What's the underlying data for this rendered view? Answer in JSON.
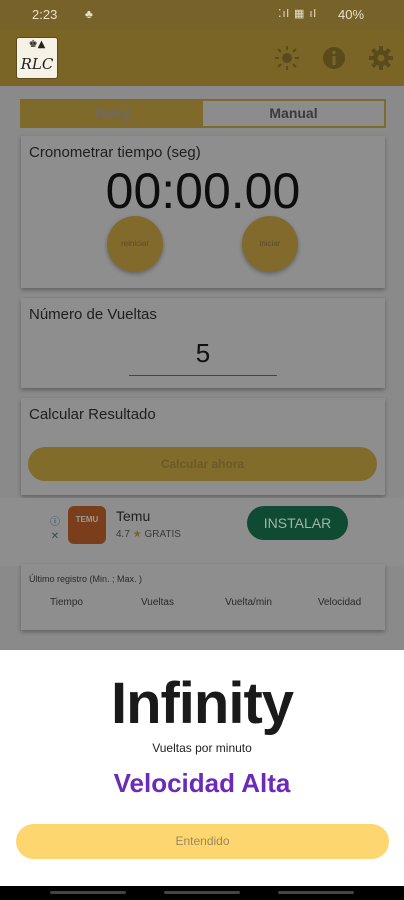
{
  "status_bar": {
    "time": "2:23",
    "notification": "♣",
    "signal": " ⁚ıl ▦ ıl",
    "battery": "40%"
  },
  "app_bar": {
    "logo_text": "RLC",
    "logo_mark": "♚▲"
  },
  "tabs": [
    {
      "label": "Reloj",
      "active": true
    },
    {
      "label": "Manual",
      "active": false
    }
  ],
  "timer_card": {
    "title": "Cronometrar tiempo (seg)",
    "time": "00:00.00",
    "reset_label": "reiniciar",
    "start_label": "iniciar"
  },
  "laps_card": {
    "title": "Número de Vueltas",
    "value": "5"
  },
  "calc_card": {
    "title": "Calcular Resultado",
    "button_label": "Calcular ahora"
  },
  "ad": {
    "app_name": "Temu",
    "rating": "4.7",
    "price": "GRATIS",
    "logo_text": "TEMU",
    "install_label": "INSTALAR"
  },
  "record": {
    "title": "Último registro (Min. ; Max. )",
    "columns": [
      "Tiempo",
      "Vueltas",
      "Vuelta/min",
      "Velocidad"
    ]
  },
  "sheet": {
    "result": "Infinity",
    "unit": "Vueltas por minuto",
    "speed": "Velocidad Alta",
    "button_label": "Entendido"
  },
  "colors": {
    "accent": "#fdd66f",
    "speed_text": "#6b2bb8",
    "status_bar": "#77632a"
  }
}
